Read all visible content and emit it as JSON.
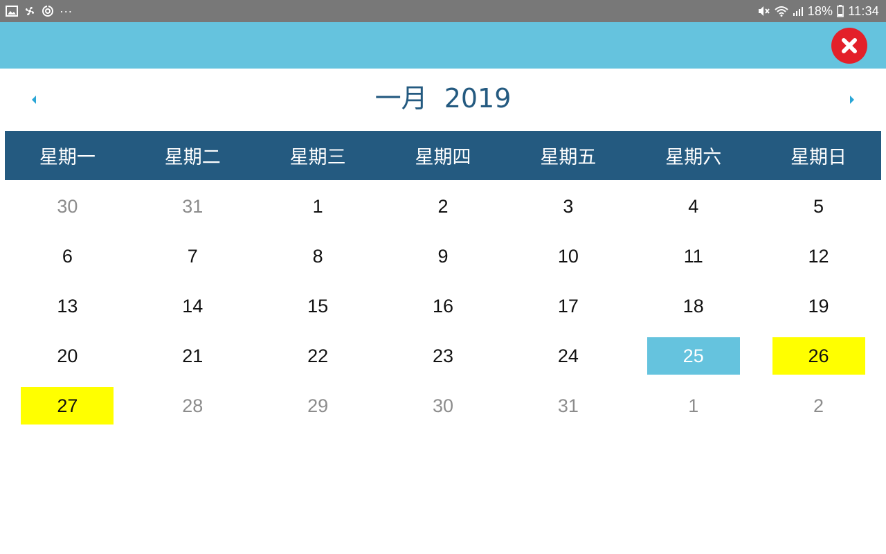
{
  "status_bar": {
    "left_icons": [
      "image-icon",
      "pinwheel-icon",
      "sync-icon",
      "more-icon"
    ],
    "more_text": "···",
    "right_icons": [
      "mute-icon",
      "wifi-icon",
      "signal-icon",
      "battery-icon"
    ],
    "battery": "18%",
    "time": "11:34"
  },
  "header": {
    "background": "#65c3de",
    "close_icon": "close-icon",
    "close_color": "#e3202a"
  },
  "calendar": {
    "month": "一月",
    "year": "2019",
    "prev_icon": "triangle-left-icon",
    "next_icon": "triangle-right-icon",
    "accent_color": "#245a80",
    "weekdays": [
      "星期一",
      "星期二",
      "星期三",
      "星期四",
      "星期五",
      "星期六",
      "星期日"
    ],
    "days": [
      {
        "label": "30",
        "state": "other"
      },
      {
        "label": "31",
        "state": "other"
      },
      {
        "label": "1",
        "state": "normal"
      },
      {
        "label": "2",
        "state": "normal"
      },
      {
        "label": "3",
        "state": "normal"
      },
      {
        "label": "4",
        "state": "normal"
      },
      {
        "label": "5",
        "state": "normal"
      },
      {
        "label": "6",
        "state": "normal"
      },
      {
        "label": "7",
        "state": "normal"
      },
      {
        "label": "8",
        "state": "normal"
      },
      {
        "label": "9",
        "state": "normal"
      },
      {
        "label": "10",
        "state": "normal"
      },
      {
        "label": "11",
        "state": "normal"
      },
      {
        "label": "12",
        "state": "normal"
      },
      {
        "label": "13",
        "state": "normal"
      },
      {
        "label": "14",
        "state": "normal"
      },
      {
        "label": "15",
        "state": "normal"
      },
      {
        "label": "16",
        "state": "normal"
      },
      {
        "label": "17",
        "state": "normal"
      },
      {
        "label": "18",
        "state": "normal"
      },
      {
        "label": "19",
        "state": "normal"
      },
      {
        "label": "20",
        "state": "normal"
      },
      {
        "label": "21",
        "state": "normal"
      },
      {
        "label": "22",
        "state": "normal"
      },
      {
        "label": "23",
        "state": "normal"
      },
      {
        "label": "24",
        "state": "normal"
      },
      {
        "label": "25",
        "state": "selected"
      },
      {
        "label": "26",
        "state": "marked"
      },
      {
        "label": "27",
        "state": "marked"
      },
      {
        "label": "28",
        "state": "other"
      },
      {
        "label": "29",
        "state": "other"
      },
      {
        "label": "30",
        "state": "other"
      },
      {
        "label": "31",
        "state": "other"
      },
      {
        "label": "1",
        "state": "other"
      },
      {
        "label": "2",
        "state": "other"
      }
    ],
    "selected_color": "#65c3de",
    "marked_color": "#ffff00"
  }
}
